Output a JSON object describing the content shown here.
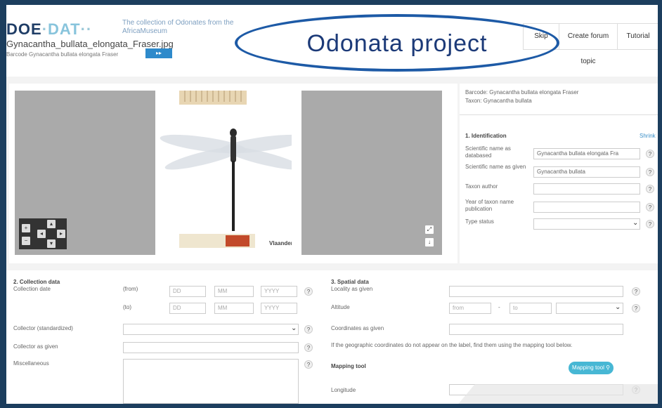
{
  "overlay": {
    "label": "Odonata project"
  },
  "header": {
    "logo_doe": "DOE",
    "logo_dot": "·",
    "logo_dat": "DAT",
    "logo_dots": "··",
    "tagline": "The collection of Odonates from the AfricaMuseum",
    "filename": "Gynacantha_bullata_elongata_Fraser.jpg",
    "barcode_line": "Barcode Gynacantha bullata elongata Fraser",
    "buttons": [
      "Skip",
      "Create forum topic",
      "Tutorial"
    ]
  },
  "viewer": {
    "icons": {
      "nav": "pan-arrows-icon",
      "zoom": "zoom-icon"
    },
    "specimen_label": "Vlaanderen"
  },
  "info": {
    "barcode": "Barcode: Gynacantha bullata elongata Fraser",
    "taxon": "Taxon: Gynacantha bullata"
  },
  "identification": {
    "title": "1. Identification",
    "shrink": "Shrink",
    "fields": [
      {
        "label": "Scientific name as databased",
        "value": "Gynacantha bullata elongata Fra"
      },
      {
        "label": "Scientific name as given",
        "value": "Gynacantha bullata"
      },
      {
        "label": "Taxon author",
        "value": ""
      },
      {
        "label": "Year of taxon name publication",
        "value": ""
      },
      {
        "label": "Type status",
        "value": ""
      }
    ]
  },
  "collection": {
    "title": "2. Collection data",
    "date_label": "Collection date",
    "from": "(from)",
    "to": "(to)",
    "dd": "DD",
    "mm": "MM",
    "yyyy": "YYYY",
    "collector_std": "Collector (standardized)",
    "collector_given": "Collector as given",
    "misc": "Miscellaneous"
  },
  "spatial": {
    "title": "3. Spatial data",
    "locality": "Locality as given",
    "altitude": "Altitude",
    "from_ph": "from",
    "to_ph": "to",
    "dash": "-",
    "coords": "Coordinates as given",
    "hint": "If the geographic coordinates do not appear on the label, find them using the mapping tool below.",
    "mapping_title": "Mapping tool",
    "mapping_btn": "Mapping tool",
    "longitude": "Longitude"
  },
  "help_glyph": "?",
  "chevron": "⌄"
}
